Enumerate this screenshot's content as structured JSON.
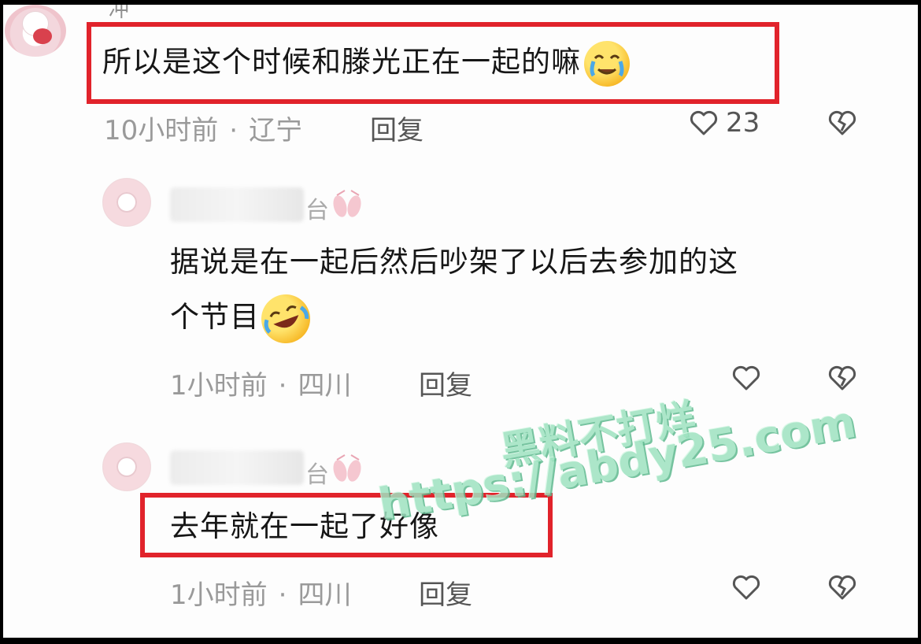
{
  "top_stub": "冲",
  "main_comment": {
    "text": "所以是这个时候和滕光正在一起的嘛",
    "emoji_icon": "crying-laughing-face-icon",
    "time": "10小时前",
    "separator": "·",
    "location": "辽宁",
    "reply_label": "回复",
    "like_count": "23"
  },
  "replies": [
    {
      "username_tail": "台",
      "text_line1": "据说是在一起后然后吵架了以后去参加的这",
      "text_line2": "个节目",
      "emoji_icon": "rolling-laughing-face-icon",
      "time": "1小时前",
      "separator": "·",
      "location": "四川",
      "reply_label": "回复"
    },
    {
      "username_tail": "台",
      "text": "去年就在一起了好像",
      "time": "1小时前",
      "separator": "·",
      "location": "四川",
      "reply_label": "回复"
    }
  ],
  "watermark": {
    "line1": "黑料不打烊",
    "line2": "https://abdy25.com"
  },
  "colors": {
    "highlight": "#e1232b",
    "watermark": "#9fe3c1",
    "meta_text": "#9a9a9a",
    "body_text": "#161616"
  }
}
